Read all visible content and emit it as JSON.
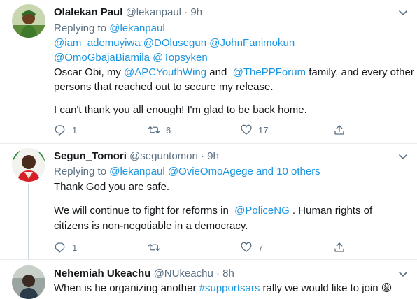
{
  "tweets": [
    {
      "name": "Olalekan Paul",
      "handle": "@lekanpaul",
      "sep": "·",
      "time": "9h",
      "replying_label": "Replying to",
      "replying_1": "@lekanpaul",
      "replying_2": "@iam_ademuyiwa @DOlusegun @JohnFanimokun",
      "replying_3": "@OmoGbajaBiamila @Topsyken",
      "body_1_pre": "Oscar Obi, my ",
      "body_1_link1": "@APCYouthWing",
      "body_1_mid": " and  ",
      "body_1_link2": "@ThePPForum",
      "body_1_post": " family, and every other",
      "body_2": "persons that reached out to secure my release.",
      "body_3": "I can't thank you all enough! I'm glad to be back home.",
      "replies": "1",
      "retweets": "6",
      "likes": "17"
    },
    {
      "name": "Segun_Tomori",
      "handle": "@seguntomori",
      "sep": "·",
      "time": "9h",
      "replying_label": "Replying to",
      "replying_1": "@lekanpaul @OvieOmoAgege and 10 others",
      "body_1": "Thank God you are safe.",
      "body_2_pre": "We will continue to fight for reforms in  ",
      "body_2_link": "@PoliceNG",
      "body_2_post": " . Human rights of",
      "body_3": "citizens is non-negotiable in a democracy.",
      "replies": "1",
      "retweets": "",
      "likes": "7"
    },
    {
      "name": "Nehemiah Ukeachu",
      "handle": "@NUkeachu",
      "sep": "·",
      "time": "8h",
      "body_1_pre": "When is he organizing another ",
      "body_1_link": "#supportsars",
      "body_1_post": " rally we would like to join ",
      "emoji": "😩"
    }
  ],
  "colors": {
    "link": "#1b95e0",
    "muted": "#5b7083",
    "divider": "#e6ecf0"
  },
  "icons": [
    "reply-icon",
    "retweet-icon",
    "like-icon",
    "share-icon",
    "chevron-down-icon"
  ]
}
